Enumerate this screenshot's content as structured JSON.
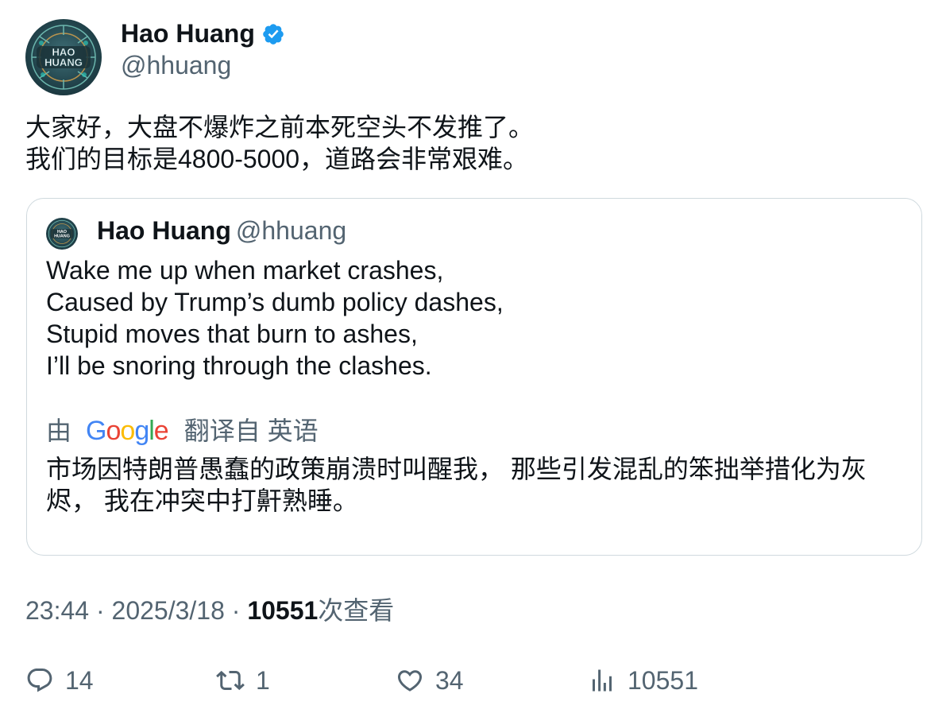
{
  "author": {
    "name": "Hao Huang",
    "handle": "@hhuang",
    "avatar_text": "HAO HUANG",
    "verified_icon": "verified-badge-icon"
  },
  "tweet": {
    "text": "大家好，大盘不爆炸之前本死空头不发推了。\n我们的目标是4800-5000，道路会非常艰难。"
  },
  "quote": {
    "name": "Hao Huang",
    "handle": "@hhuang",
    "text": "Wake me up when market crashes,\nCaused by Trump’s dumb policy dashes,\nStupid moves that burn to ashes,\nI’ll be snoring through the clashes.",
    "translation": {
      "prefix": "由",
      "provider_logo": "Google",
      "suffix": "翻译自 英语",
      "text": "市场因特朗普愚蠢的政策崩溃时叫醒我， 那些引发混乱的笨拙举措化为灰烬， 我在冲突中打鼾熟睡。"
    }
  },
  "meta": {
    "time": "23:44",
    "separator": "·",
    "date": "2025/3/18",
    "views_count": "10551",
    "views_label": "次查看"
  },
  "actions": {
    "replies": "14",
    "retweets": "1",
    "likes": "34",
    "views": "10551"
  },
  "colors": {
    "text": "#0f1419",
    "secondary": "#536471",
    "border": "#cfd9de",
    "verified": "#1d9bf0"
  }
}
